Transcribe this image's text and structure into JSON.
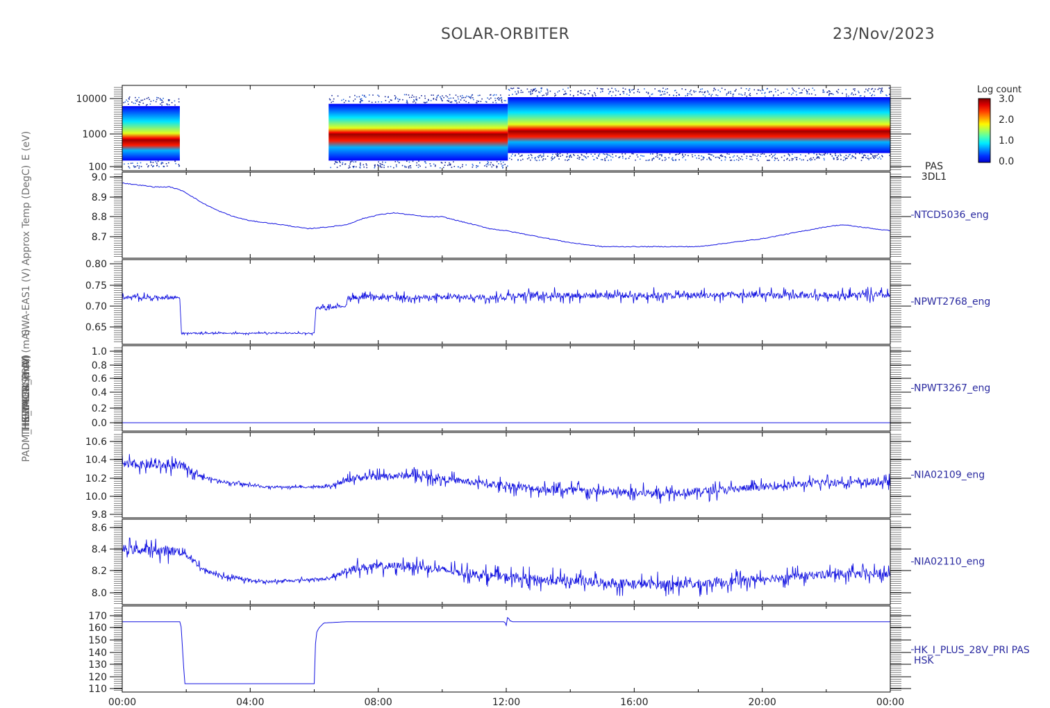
{
  "header": {
    "title": "SOLAR-ORBITER",
    "date": "23/Nov/2023"
  },
  "colorbar": {
    "label": "Log count",
    "ticks": [
      "3.0",
      "2.0",
      "1.0",
      "0.0"
    ]
  },
  "x_axis": {
    "ticks": [
      "00:00",
      "04:00",
      "08:00",
      "12:00",
      "16:00",
      "20:00",
      "00:00"
    ]
  },
  "panels": [
    {
      "id": "pas",
      "type": "spectrogram",
      "ytick_labels": [
        "10000",
        "1000",
        "100"
      ],
      "side_label_lines": [
        "PAS",
        "3DL1"
      ],
      "ylabel": "E (eV)"
    },
    {
      "id": "ntcd",
      "type": "line",
      "ytick_labels": [
        "9.0",
        "8.9",
        "8.8",
        "8.7"
      ],
      "side_label_lines": [
        "NTCD5036_eng"
      ],
      "ylabel": "Approx Temp (DegC)"
    },
    {
      "id": "npwt2768",
      "type": "line",
      "ytick_labels": [
        "0.80",
        "0.75",
        "0.70",
        "0.65"
      ],
      "side_label_lines": [
        "NPWT2768_eng"
      ],
      "ylabel": "SWA-EAS1 (V)"
    },
    {
      "id": "npwt3267",
      "type": "line",
      "ytick_labels": [
        "1.0",
        "0.8",
        "0.6",
        "0.4",
        "0.2",
        "0.0"
      ],
      "side_label_lines": [
        "NPWT3267_eng"
      ],
      "ylabel": "SWA-EAS2 (V)"
    },
    {
      "id": "nia02109",
      "type": "line",
      "ytick_labels": [
        "10.6",
        "10.4",
        "10.2",
        "10.0",
        "9.8"
      ],
      "side_label_lines": [
        "NIA02109_eng"
      ],
      "ylabel": "THERMCA4 (mA)"
    },
    {
      "id": "nia02110",
      "type": "line",
      "ytick_labels": [
        "8.6",
        "8.4",
        "8.2",
        "8.0"
      ],
      "side_label_lines": [
        "NIA02110_eng"
      ],
      "ylabel": "THERMCB (mA)"
    },
    {
      "id": "hk",
      "type": "line",
      "ytick_labels": [
        "170",
        "160",
        "150",
        "140",
        "130",
        "120",
        "110"
      ],
      "side_label_lines": [
        "HK_I_PLUS_28V_PRI PAS",
        "HSK"
      ],
      "ylabel": "PADM_HK_IMON_PRIM (mA)"
    }
  ],
  "chart_data": [
    {
      "type": "heatmap",
      "panel": "pas",
      "title": "",
      "ylabel": "E (eV)",
      "ylog": true,
      "ylim": [
        100,
        15000
      ],
      "xlim": [
        "00:00",
        "24:00"
      ],
      "colorbar": {
        "label": "Log count",
        "range": [
          0.0,
          3.0
        ]
      },
      "segments": [
        {
          "x_start": 0.0,
          "x_end": 1.8,
          "peak_energy": 600,
          "e_low": 150,
          "e_high": 6000
        },
        {
          "x_start": 6.45,
          "x_end": 12.05,
          "peak_energy": 900,
          "e_low": 150,
          "e_high": 7000
        },
        {
          "x_start": 12.05,
          "x_end": 24.0,
          "peak_energy": 1100,
          "e_low": 250,
          "e_high": 11000
        }
      ]
    },
    {
      "type": "line",
      "panel": "ntcd",
      "series": [
        {
          "name": "NTCD5036_eng",
          "x": [
            0,
            0.5,
            1,
            1.5,
            1.9,
            2.5,
            3,
            3.5,
            4,
            5,
            5.8,
            6.5,
            7,
            7.5,
            8,
            8.5,
            9,
            9.5,
            10,
            10.5,
            11,
            11.5,
            12,
            13,
            14,
            15,
            16,
            17,
            18,
            19,
            20,
            21,
            22,
            22.5,
            23,
            24
          ],
          "y": [
            8.97,
            8.96,
            8.95,
            8.95,
            8.93,
            8.87,
            8.83,
            8.8,
            8.78,
            8.76,
            8.74,
            8.75,
            8.76,
            8.79,
            8.81,
            8.82,
            8.81,
            8.8,
            8.8,
            8.78,
            8.76,
            8.74,
            8.73,
            8.7,
            8.67,
            8.65,
            8.65,
            8.65,
            8.65,
            8.67,
            8.69,
            8.72,
            8.75,
            8.76,
            8.75,
            8.73
          ]
        }
      ],
      "ylim": [
        8.62,
        9.0
      ],
      "xlim": [
        "00:00",
        "24:00"
      ]
    },
    {
      "type": "line",
      "panel": "npwt2768",
      "series": [
        {
          "name": "NPWT2768_eng",
          "x": [
            0,
            1.8,
            1.85,
            6.0,
            6.05,
            7.0,
            7.05,
            12.0,
            12.05,
            24.0
          ],
          "y": [
            0.72,
            0.72,
            0.635,
            0.635,
            0.695,
            0.7,
            0.72,
            0.72,
            0.725,
            0.725
          ],
          "noise": [
            0.012,
            0.012,
            0.004,
            0.004,
            0.008,
            0.008,
            0.015,
            0.015,
            0.02,
            0.02
          ]
        }
      ],
      "ylim": [
        0.62,
        0.8
      ],
      "xlim": [
        "00:00",
        "24:00"
      ]
    },
    {
      "type": "line",
      "panel": "npwt3267",
      "series": [
        {
          "name": "NPWT3267_eng",
          "x": [
            0,
            24
          ],
          "y": [
            0.0,
            0.0
          ]
        }
      ],
      "ylim": [
        -0.05,
        1.0
      ],
      "xlim": [
        "00:00",
        "24:00"
      ]
    },
    {
      "type": "line",
      "panel": "nia02109",
      "series": [
        {
          "name": "NIA02109_eng",
          "x": [
            0,
            1.9,
            2.6,
            3.3,
            4.5,
            6.5,
            7.2,
            9.0,
            11.0,
            13.0,
            16.0,
            18.0,
            20.0,
            22.0,
            24.0
          ],
          "y": [
            10.35,
            10.33,
            10.2,
            10.15,
            10.1,
            10.1,
            10.2,
            10.23,
            10.15,
            10.08,
            10.03,
            10.05,
            10.1,
            10.15,
            10.15
          ],
          "noise": [
            0.12,
            0.12,
            0.05,
            0.04,
            0.03,
            0.03,
            0.1,
            0.1,
            0.1,
            0.12,
            0.12,
            0.12,
            0.1,
            0.1,
            0.1
          ]
        }
      ],
      "ylim": [
        9.77,
        10.65
      ],
      "xlim": [
        "00:00",
        "24:00"
      ]
    },
    {
      "type": "line",
      "panel": "nia02110",
      "series": [
        {
          "name": "NIA02110_eng",
          "x": [
            0,
            1.9,
            2.6,
            3.3,
            4.5,
            6.5,
            7.2,
            9.0,
            11.0,
            13.0,
            16.0,
            18.0,
            20.0,
            22.0,
            24.0
          ],
          "y": [
            8.4,
            8.38,
            8.2,
            8.14,
            8.1,
            8.13,
            8.23,
            8.25,
            8.17,
            8.12,
            8.08,
            8.08,
            8.13,
            8.17,
            8.17
          ],
          "noise": [
            0.12,
            0.12,
            0.05,
            0.04,
            0.03,
            0.03,
            0.1,
            0.1,
            0.1,
            0.12,
            0.12,
            0.12,
            0.1,
            0.1,
            0.1
          ]
        }
      ],
      "ylim": [
        7.93,
        8.62
      ],
      "xlim": [
        "00:00",
        "24:00"
      ]
    },
    {
      "type": "line",
      "panel": "hk",
      "series": [
        {
          "name": "HK_I_PLUS_28V_PRI PAS HSK",
          "x": [
            0,
            1.83,
            1.88,
            1.95,
            6.0,
            6.05,
            6.15,
            6.3,
            7.0,
            11.95,
            12.0,
            12.05,
            12.1,
            12.2,
            24.0
          ],
          "y": [
            165,
            165,
            145,
            114,
            114,
            155,
            160,
            164,
            165,
            165,
            162,
            170,
            166,
            165,
            165
          ]
        }
      ],
      "ylim": [
        108,
        173
      ],
      "xlim": [
        "00:00",
        "24:00"
      ]
    }
  ]
}
